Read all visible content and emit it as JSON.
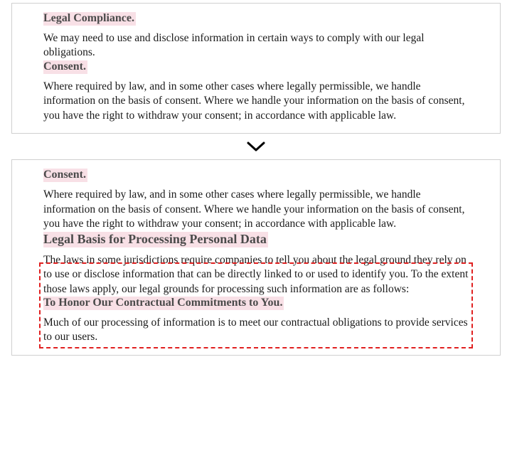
{
  "top": {
    "sec1": {
      "heading": "Legal Compliance.",
      "body": "We may need to use and disclose information in certain ways to comply with our legal obligations."
    },
    "sec2": {
      "heading": "Consent.",
      "body": "Where required by law, and in some other cases where legally permissible, we handle information on the basis of consent. Where we handle your information on the basis of consent, you have the right to withdraw your consent; in accordance with applicable law."
    }
  },
  "bottom": {
    "sec1": {
      "heading": "Consent.",
      "body": "Where required by law, and in some other cases where legally permissible, we handle information on the basis of consent. Where we handle your information on the basis of consent, you have the right to withdraw your consent; in accordance with applicable law."
    },
    "sec2": {
      "heading": "Legal Basis for Processing Personal Data",
      "body": "The laws in some jurisdictions require companies to tell you about the legal ground they rely on to use or disclose information that can be directly linked to or used to identify you. To the extent those laws apply, our legal grounds for processing such information are as follows:"
    },
    "sec3": {
      "heading": "To Honor Our Contractual Commitments to You.",
      "body": "Much of our processing of information is to meet our contractual obligations to provide services to our users."
    }
  }
}
